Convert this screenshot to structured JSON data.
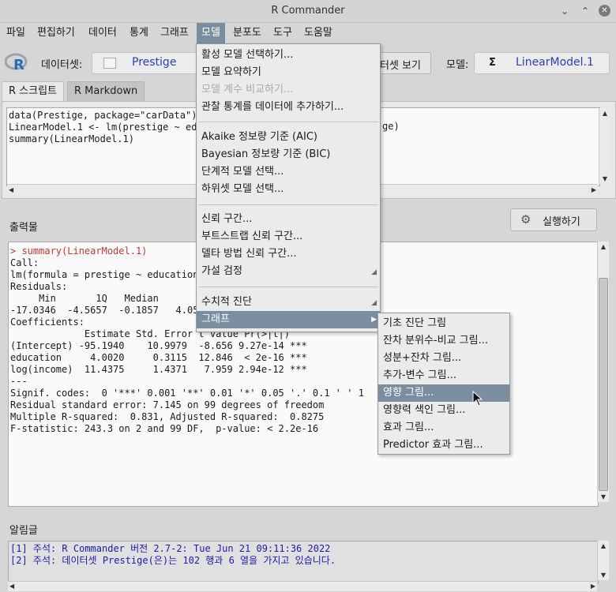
{
  "window": {
    "title": "R Commander"
  },
  "menubar": {
    "items": [
      "파일",
      "편집하기",
      "데이터",
      "통계",
      "그래프",
      "모델",
      "분포도",
      "도구",
      "도움말"
    ],
    "active_index": 5
  },
  "toolbar": {
    "dataset_label": "데이터셋:",
    "dataset_value": "Prestige",
    "view_dataset_button": "터셋 보기",
    "model_label": "모델:",
    "model_symbol": "Σ",
    "model_value": "LinearModel.1"
  },
  "tabs": [
    "R 스크립트",
    "R Markdown"
  ],
  "script": {
    "lines": [
      "data(Prestige, package=\"carData\")",
      "LinearModel.1 <- lm(prestige ~ edu",
      "summary(LinearModel.1)"
    ],
    "line2_tail": "ge)"
  },
  "output": {
    "label": "출력물",
    "run_button": "실행하기",
    "cmd_line": "> summary(LinearModel.1)",
    "lines": [
      "",
      "",
      "Call:",
      "lm(formula = prestige ~ education",
      "",
      "Residuals:",
      "     Min       1Q   Median       3Q      Max",
      "-17.0346  -4.5657  -0.1857   4.0577  18.1270",
      "",
      "Coefficients:",
      "             Estimate Std. Error t value Pr(>|t|)",
      "(Intercept) -95.1940    10.9979  -8.656 9.27e-14 ***",
      "education     4.0020     0.3115  12.846  < 2e-16 ***",
      "log(income)  11.4375     1.4371   7.959 2.94e-12 ***",
      "---",
      "Signif. codes:  0 '***' 0.001 '**' 0.01 '*' 0.05 '.' 0.1 ' ' 1",
      "",
      "Residual standard error: 7.145 on 99 degrees of freedom",
      "Multiple R-squared:  0.831, Adjusted R-squared:  0.8275",
      "F-statistic: 243.3 on 2 and 99 DF,  p-value: < 2.2e-16"
    ]
  },
  "messages": {
    "label": "알림글",
    "lines": [
      "[1] 주석: R Commander 버전 2.7-2: Tue Jun 21 09:11:36 2022",
      "[2] 주석: 데이터셋 Prestige(은)는 102 행과 6 열을 가지고 있습니다."
    ]
  },
  "model_menu": {
    "items": [
      {
        "label": "활성 모델 선택하기...",
        "disabled": false
      },
      {
        "label": "모델 요약하기",
        "disabled": false
      },
      {
        "label": "모델 계수 비교하기...",
        "disabled": true
      },
      {
        "label": "관찰 통계를 데이터에 추가하기...",
        "disabled": false
      },
      {
        "label": "Akaike 정보량 기준 (AIC)",
        "disabled": false
      },
      {
        "label": "Bayesian 정보량 기준 (BIC)",
        "disabled": false
      },
      {
        "label": "단계적 모델 선택...",
        "disabled": false
      },
      {
        "label": "하위셋 모델 선택...",
        "disabled": false
      },
      {
        "label": "신뢰 구간...",
        "disabled": false
      },
      {
        "label": "부트스트랩 신뢰 구간...",
        "disabled": false
      },
      {
        "label": "델타 방법 신뢰 구간...",
        "disabled": false
      },
      {
        "label": "가설 검정",
        "disabled": false,
        "submenu": true
      },
      {
        "label": "수치적 진단",
        "disabled": false,
        "submenu": true
      },
      {
        "label": "그래프",
        "disabled": false,
        "submenu": true,
        "highlighted": true
      }
    ]
  },
  "graph_submenu": {
    "items": [
      {
        "label": "기초 진단 그림"
      },
      {
        "label": "잔차 분위수-비교 그림..."
      },
      {
        "label": "성분+잔차 그림..."
      },
      {
        "label": "추가-변수 그림..."
      },
      {
        "label": "영향 그림...",
        "highlighted": true
      },
      {
        "label": "영향력 색인 그림..."
      },
      {
        "label": "효과 그림..."
      },
      {
        "label": "Predictor 효과 그림..."
      }
    ]
  },
  "colors": {
    "highlight": "#7a8ea0",
    "prompt_red": "#c0392b",
    "message_blue": "#1a1ab0",
    "field_text": "#2a3fb8"
  }
}
